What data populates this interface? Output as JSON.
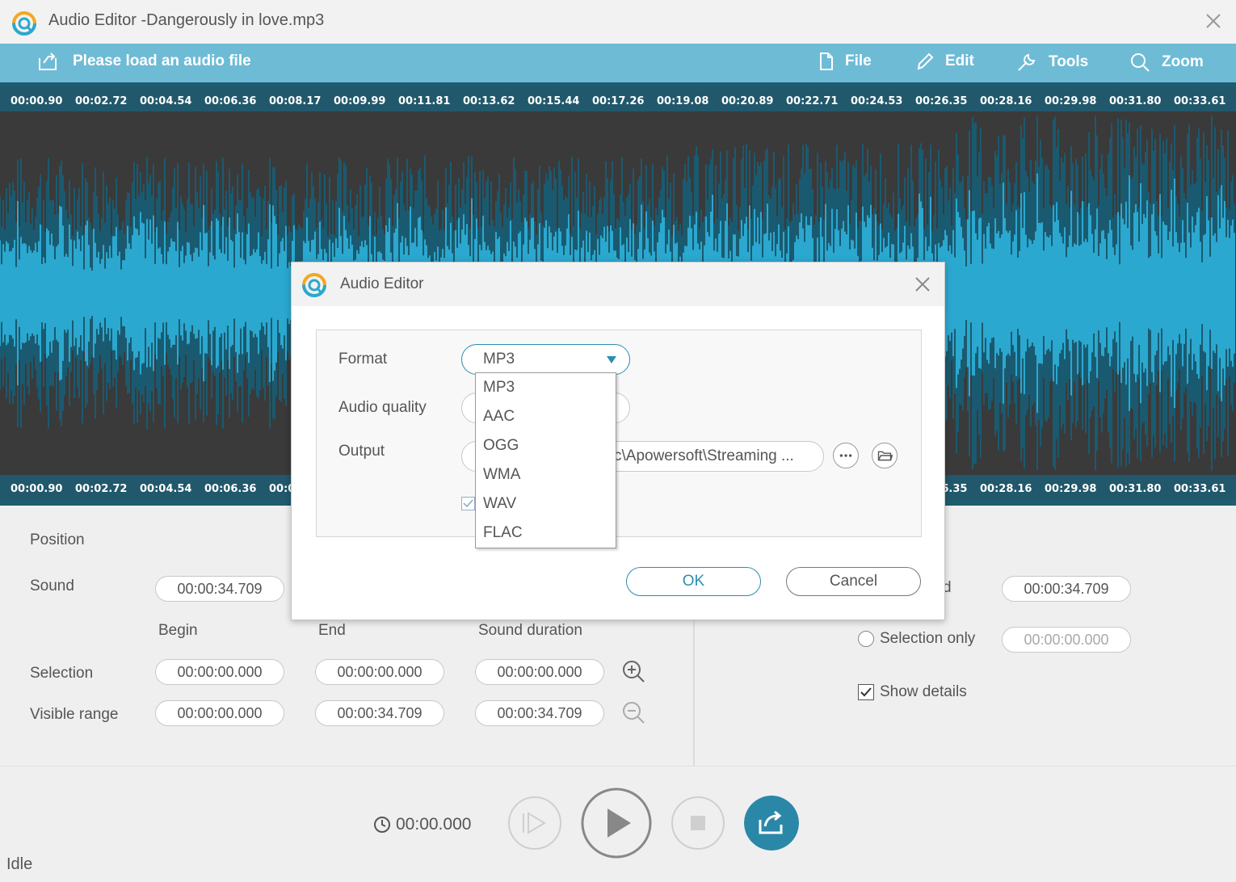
{
  "window": {
    "title": "Audio Editor  -Dangerously in love.mp3"
  },
  "toolbar": {
    "load_label": "Please load an audio file",
    "file_label": "File",
    "edit_label": "Edit",
    "tools_label": "Tools",
    "zoom_label": "Zoom"
  },
  "ruler": {
    "ticks": [
      "00:00.90",
      "00:02.72",
      "00:04.54",
      "00:06.36",
      "00:08.17",
      "00:09.99",
      "00:11.81",
      "00:13.62",
      "00:15.44",
      "00:17.26",
      "00:19.08",
      "00:20.89",
      "00:22.71",
      "00:24.53",
      "00:26.35",
      "00:28.16",
      "00:29.98",
      "00:31.80",
      "00:33.61"
    ]
  },
  "colors": {
    "toolbar_bg": "#6ebbd6",
    "wave_dark": "#1a5a70",
    "wave_light": "#2ba8cf",
    "accent": "#2c8fb0"
  },
  "panel": {
    "position_label": "Position",
    "sound_label": "Sound",
    "sound_value": "00:00:34.709",
    "begin_header": "Begin",
    "end_header": "End",
    "duration_header": "Sound duration",
    "selection_label": "Selection",
    "selection_begin": "00:00:00.000",
    "selection_end": "00:00:00.000",
    "selection_duration": "00:00:00.000",
    "visible_label": "Visible range",
    "visible_begin": "00:00:00.000",
    "visible_end": "00:00:34.709",
    "visible_duration": "00:00:34.709",
    "right_partial_label": "d",
    "right_sound_value": "00:00:34.709",
    "selection_only_label": "Selection only",
    "selection_only_value": "00:00:00.000",
    "show_details_label": "Show details"
  },
  "player": {
    "time": "00:00.000",
    "status": "Idle"
  },
  "dialog": {
    "title": "Audio Editor",
    "format_label": "Format",
    "format_value": "MP3",
    "quality_label": "Audio quality",
    "output_label": "Output",
    "output_path": "c\\Apowersoft\\Streaming ...",
    "options": [
      "MP3",
      "AAC",
      "OGG",
      "WMA",
      "WAV",
      "FLAC"
    ],
    "ok_label": "OK",
    "cancel_label": "Cancel"
  }
}
